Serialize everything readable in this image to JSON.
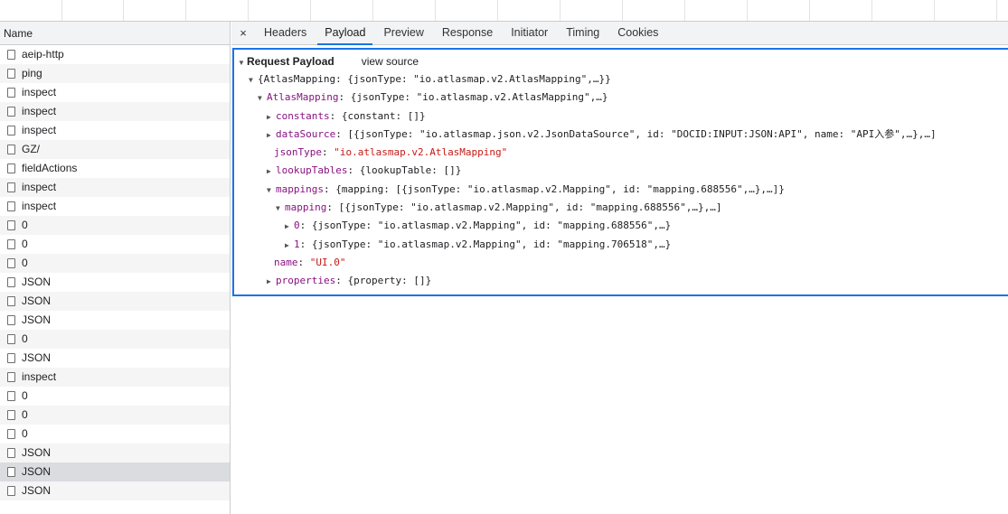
{
  "list": {
    "header": "Name",
    "rows": [
      {
        "name": "aeip-http"
      },
      {
        "name": "ping"
      },
      {
        "name": "inspect"
      },
      {
        "name": "inspect"
      },
      {
        "name": "inspect"
      },
      {
        "name": "GZ/"
      },
      {
        "name": "fieldActions"
      },
      {
        "name": "inspect"
      },
      {
        "name": "inspect"
      },
      {
        "name": "0"
      },
      {
        "name": "0"
      },
      {
        "name": "0"
      },
      {
        "name": "JSON"
      },
      {
        "name": "JSON"
      },
      {
        "name": "JSON"
      },
      {
        "name": "0"
      },
      {
        "name": "JSON"
      },
      {
        "name": "inspect"
      },
      {
        "name": "0"
      },
      {
        "name": "0"
      },
      {
        "name": "0"
      },
      {
        "name": "JSON"
      },
      {
        "name": "JSON"
      },
      {
        "name": "JSON"
      }
    ]
  },
  "tabs": {
    "close": "×",
    "items": [
      "Headers",
      "Payload",
      "Preview",
      "Response",
      "Initiator",
      "Timing",
      "Cookies"
    ],
    "active": "Payload"
  },
  "payload": {
    "title": "Request Payload",
    "view_source": "view source",
    "lines": [
      {
        "key": "",
        "value": "{AtlasMapping: {jsonType: \"io.atlasmap.v2.AtlasMapping\",…}}"
      },
      {
        "key": "AtlasMapping",
        "value": "{jsonType: \"io.atlasmap.v2.AtlasMapping\",…}"
      },
      {
        "key": "constants",
        "value": "{constant: []}"
      },
      {
        "key": "dataSource",
        "value": "[{jsonType: \"io.atlasmap.json.v2.JsonDataSource\", id: \"DOCID:INPUT:JSON:API\", name: \"API入参\",…},…]"
      },
      {
        "key": "jsonType",
        "value": "\"io.atlasmap.v2.AtlasMapping\""
      },
      {
        "key": "lookupTables",
        "value": "{lookupTable: []}"
      },
      {
        "key": "mappings",
        "value": "{mapping: [{jsonType: \"io.atlasmap.v2.Mapping\", id: \"mapping.688556\",…},…]}"
      },
      {
        "key": "mapping",
        "value": "[{jsonType: \"io.atlasmap.v2.Mapping\", id: \"mapping.688556\",…},…]"
      },
      {
        "key": "0",
        "value": "{jsonType: \"io.atlasmap.v2.Mapping\", id: \"mapping.688556\",…}"
      },
      {
        "key": "1",
        "value": "{jsonType: \"io.atlasmap.v2.Mapping\", id: \"mapping.706518\",…}"
      },
      {
        "key": "name",
        "value": "\"UI.0\""
      },
      {
        "key": "properties",
        "value": "{property: []}"
      }
    ]
  }
}
